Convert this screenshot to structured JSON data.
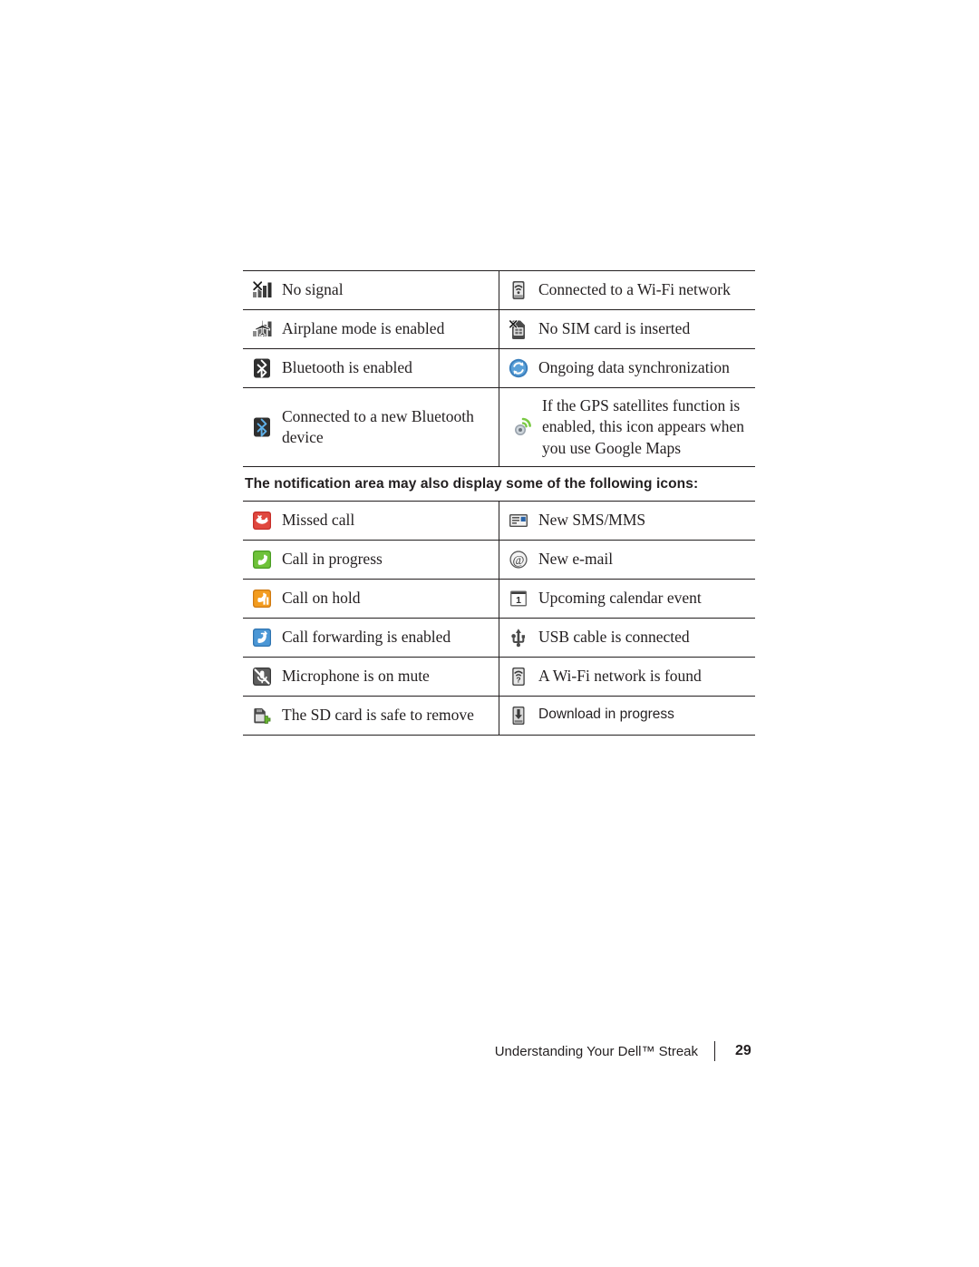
{
  "document": {
    "status_icons_table": {
      "rows": [
        {
          "left": {
            "icon": "no-signal-icon",
            "label": "No signal"
          },
          "right": {
            "icon": "wifi-connected-icon",
            "label": "Connected to a Wi-Fi network"
          }
        },
        {
          "left": {
            "icon": "airplane-mode-icon",
            "label": "Airplane mode is enabled"
          },
          "right": {
            "icon": "no-sim-card-icon",
            "label": "No SIM card is inserted"
          }
        },
        {
          "left": {
            "icon": "bluetooth-enabled-icon",
            "label": "Bluetooth is enabled"
          },
          "right": {
            "icon": "data-sync-icon",
            "label": "Ongoing data synchronization"
          }
        },
        {
          "left": {
            "icon": "bluetooth-connected-icon",
            "label": "Connected to a new Bluetooth device"
          },
          "right": {
            "icon": "gps-icon",
            "label": "If the GPS satellites function is enabled, this icon appears when you use Google Maps"
          }
        }
      ]
    },
    "section_heading": "The notification area may also display some of the following icons:",
    "notification_icons_table": {
      "rows": [
        {
          "left": {
            "icon": "missed-call-icon",
            "label": "Missed call"
          },
          "right": {
            "icon": "new-sms-mms-icon",
            "label": "New SMS/MMS"
          }
        },
        {
          "left": {
            "icon": "call-in-progress-icon",
            "label": "Call in progress"
          },
          "right": {
            "icon": "new-email-icon",
            "label": "New e-mail"
          }
        },
        {
          "left": {
            "icon": "call-on-hold-icon",
            "label": "Call on hold"
          },
          "right": {
            "icon": "calendar-event-icon",
            "label": "Upcoming calendar event"
          }
        },
        {
          "left": {
            "icon": "call-forwarding-icon",
            "label": "Call forwarding is enabled"
          },
          "right": {
            "icon": "usb-cable-icon",
            "label": "USB cable is connected"
          }
        },
        {
          "left": {
            "icon": "microphone-mute-icon",
            "label": "Microphone is on mute"
          },
          "right": {
            "icon": "wifi-found-icon",
            "label": "A Wi-Fi network is found"
          }
        },
        {
          "left": {
            "icon": "sd-card-safe-icon",
            "label": "The SD card is safe to remove"
          },
          "right": {
            "icon": "download-progress-icon",
            "label": "Download in progress",
            "font": "sans"
          }
        }
      ]
    },
    "footer": {
      "title": "Understanding Your Dell™ Streak",
      "page_number": "29"
    }
  },
  "colors": {
    "rule": "#231f20",
    "text": "#231f20",
    "icon_dark": "#3b3b3b",
    "icon_blue": "#3f8fd0",
    "icon_green": "#5bb030",
    "icon_orange": "#f08b1d",
    "icon_red": "#d93a2b",
    "icon_gray": "#8a8a8a"
  }
}
